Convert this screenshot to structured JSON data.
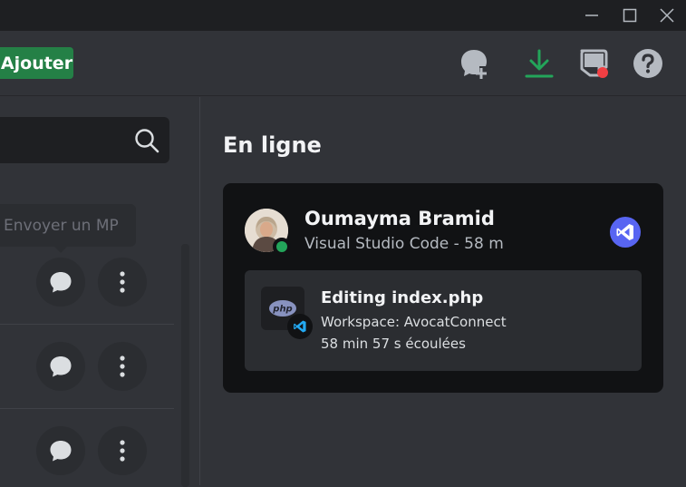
{
  "toolbar": {
    "add_label": "Ajouter",
    "icons": [
      "new-group-dm-icon",
      "download-icon",
      "inbox-icon",
      "help-icon"
    ],
    "accent_green": "#23a55a",
    "badge_red": "#f23f43"
  },
  "sidebar": {
    "tooltip": "Envoyer un MP"
  },
  "online": {
    "heading": "En ligne",
    "user": {
      "name": "Oumayma Bramid",
      "activity": "Visual Studio Code - 58 m",
      "status": "online"
    },
    "rich_presence": {
      "title": "Editing index.php",
      "workspace": "Workspace: AvocatConnect",
      "elapsed": "58 min 57 s écoulées",
      "large_image": "php-icon",
      "small_image": "vscode-icon"
    }
  },
  "window": {
    "controls": [
      "minimize",
      "maximize",
      "close"
    ]
  }
}
